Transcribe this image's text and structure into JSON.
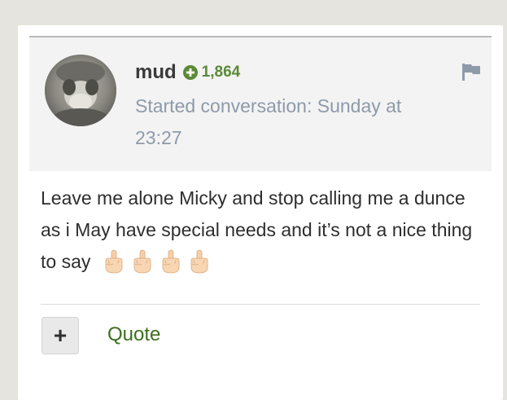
{
  "post": {
    "author": "mud",
    "reputation": "1,864",
    "meta_line1": "Started conversation: Sunday at",
    "meta_line2": "23:27",
    "body_text": "Leave me alone Micky and stop calling me a dunce as i May have special needs and it’s not a nice thing to say",
    "emoji_count": 4
  },
  "actions": {
    "plus_label": "+",
    "quote_label": "Quote"
  },
  "colors": {
    "reputation_green": "#5a8a36",
    "meta_gray": "#8e9aaa",
    "quote_green": "#3d6e1e",
    "header_bg": "#f3f3f3"
  },
  "icons": {
    "reputation": "plus-circle-icon",
    "report": "flag-icon",
    "emoji": "middle-finger-emoji"
  }
}
